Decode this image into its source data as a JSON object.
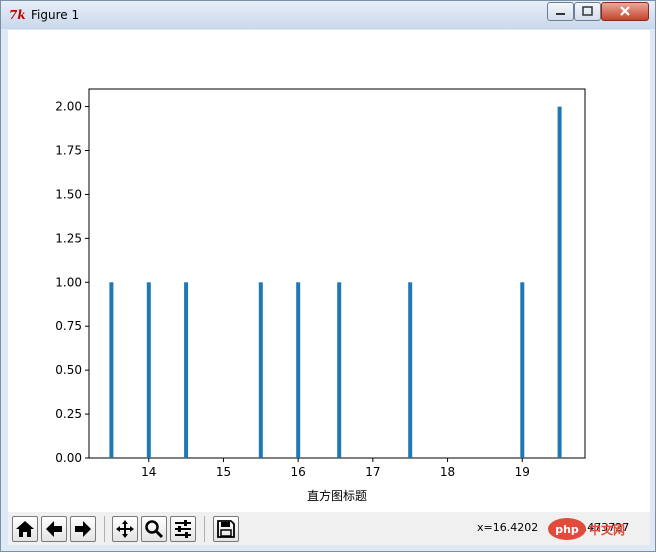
{
  "window": {
    "title": "Figure 1",
    "minimize_icon": "minimize-icon",
    "maximize_icon": "maximize-icon",
    "close_icon": "close-icon",
    "app_icon": "tk-icon"
  },
  "toolbar": {
    "buttons": [
      {
        "name": "home",
        "icon": "home-icon"
      },
      {
        "name": "back",
        "icon": "arrow-left-icon"
      },
      {
        "name": "forward",
        "icon": "arrow-right-icon"
      },
      {
        "name": "pan",
        "icon": "move-icon"
      },
      {
        "name": "zoom",
        "icon": "magnifier-icon"
      },
      {
        "name": "configure-subplots",
        "icon": "sliders-icon"
      },
      {
        "name": "save",
        "icon": "floppy-icon"
      }
    ],
    "x_readout": "x=16.4202",
    "y_readout": "y=1.473727"
  },
  "watermark": {
    "text": "php 中文网"
  },
  "chart_data": {
    "type": "bar",
    "title": "",
    "xlabel": "直方图标题",
    "ylabel": "",
    "x": [
      13.5,
      14.0,
      14.5,
      15.5,
      16.0,
      16.55,
      17.5,
      19.0,
      19.5
    ],
    "values": [
      1,
      1,
      1,
      1,
      1,
      1,
      1,
      1,
      2
    ],
    "xlim": [
      13.2,
      19.84
    ],
    "ylim": [
      0,
      2.1
    ],
    "xticks": [
      "14",
      "15",
      "16",
      "17",
      "18",
      "19"
    ],
    "yticks": [
      "0.00",
      "0.25",
      "0.50",
      "0.75",
      "1.00",
      "1.25",
      "1.50",
      "1.75",
      "2.00"
    ],
    "bar_color": "#1f77b4",
    "grid": false
  }
}
